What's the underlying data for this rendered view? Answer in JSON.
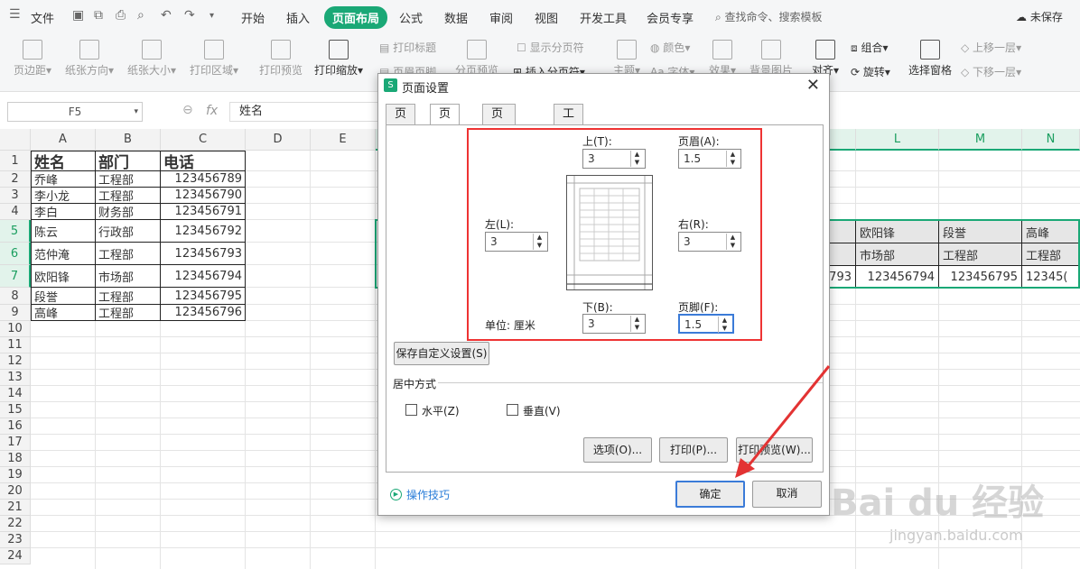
{
  "topbar": {
    "file": "文件",
    "tabs": [
      "开始",
      "插入",
      "页面布局",
      "公式",
      "数据",
      "审阅",
      "视图",
      "开发工具",
      "会员专享"
    ],
    "active_tab": "页面布局",
    "search": "查找命令、搜索模板",
    "status": "未保存"
  },
  "ribbon": {
    "margins": "页边距",
    "orientation": "纸张方向",
    "size": "纸张大小",
    "print_area": "打印区域",
    "print_preview": "打印预览",
    "print_scale": "打印缩放",
    "print_titles": "打印标题",
    "header_footer": "页眉页脚",
    "page_break_preview": "分页预览",
    "show_page_break": "显示分页符",
    "insert_page_break": "插入分页符",
    "theme": "主题",
    "colors": "颜色",
    "fonts": "字体",
    "effects": "效果",
    "background": "背景图片",
    "align": "对齐",
    "group": "组合",
    "rotate": "旋转",
    "selection_pane": "选择窗格",
    "bring_forward": "上移一层",
    "send_backward": "下移一层"
  },
  "formula": {
    "name_box": "F5",
    "fx": "fx",
    "content": "姓名"
  },
  "sheet": {
    "columns": [
      "A",
      "B",
      "C",
      "D",
      "E",
      "L",
      "M",
      "N"
    ],
    "rows": [
      "1",
      "2",
      "3",
      "4",
      "5",
      "6",
      "7",
      "8",
      "9",
      "10",
      "11",
      "12",
      "13",
      "14",
      "15",
      "16",
      "17",
      "18",
      "19",
      "20",
      "21",
      "22",
      "23",
      "24"
    ],
    "header": [
      "姓名",
      "部门",
      "电话"
    ],
    "data": [
      [
        "乔峰",
        "工程部",
        "123456789"
      ],
      [
        "李小龙",
        "工程部",
        "123456790"
      ],
      [
        "李白",
        "财务部",
        "123456791"
      ],
      [
        "陈云",
        "行政部",
        "123456792"
      ],
      [
        "范仲淹",
        "工程部",
        "123456793"
      ],
      [
        "欧阳锋",
        "市场部",
        "123456794"
      ],
      [
        "段誉",
        "工程部",
        "123456795"
      ],
      [
        "高峰",
        "工程部",
        "123456796"
      ]
    ],
    "right_names": [
      "欧阳锋",
      "段誉",
      "高峰"
    ],
    "right_depts": [
      "市场部",
      "工程部",
      "工程部"
    ],
    "right_phones": [
      "793",
      "123456794",
      "123456795",
      "12345("
    ]
  },
  "dialog": {
    "title": "页面设置",
    "close": "✕",
    "tabs": [
      "页面",
      "页边距",
      "页眉/页脚",
      "工作表"
    ],
    "active_tab": "页边距",
    "top_label": "上(T):",
    "top_value": "3",
    "header_label": "页眉(A):",
    "header_value": "1.5",
    "left_label": "左(L):",
    "left_value": "3",
    "right_label": "右(R):",
    "right_value": "3",
    "bottom_label": "下(B):",
    "bottom_value": "3",
    "footer_label": "页脚(F):",
    "footer_value": "1.5",
    "unit_label": "单位: 厘米",
    "save_custom": "保存自定义设置(S)",
    "center_section": "居中方式",
    "horizontal": "水平(Z)",
    "vertical": "垂直(V)",
    "options_btn": "选项(O)...",
    "print_btn": "打印(P)...",
    "preview_btn": "打印预览(W)...",
    "tips": "操作技巧",
    "ok": "确定",
    "cancel": "取消"
  },
  "watermark": {
    "brand": "Bai du 经验",
    "url": "jingyan.baidu.com"
  },
  "colors": {
    "accent": "#1aa876",
    "highlight_box": "#e33333",
    "arrow": "#e33333",
    "focus": "#3b7bd8"
  }
}
